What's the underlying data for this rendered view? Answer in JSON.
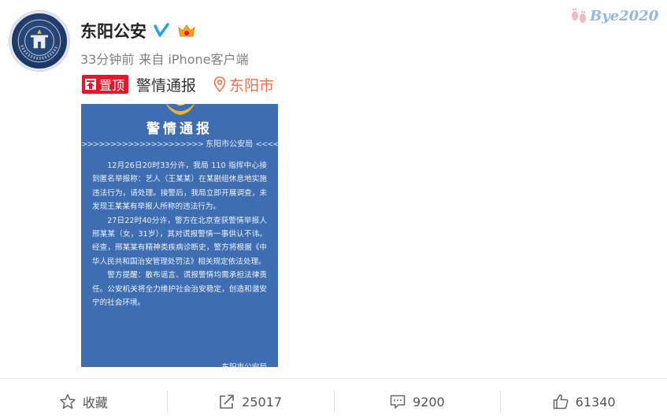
{
  "user": {
    "name": "东阳公安",
    "meta": {
      "time": "33分钟前",
      "source": "来自 iPhone客户端"
    }
  },
  "post": {
    "pin_label": "置顶",
    "text": "警情通报",
    "location": "东阳市"
  },
  "notice": {
    "title": "警情通报",
    "subtitle": "东阳市公安局",
    "arrows_left": ">>>>>>>>>>>>>>>>>>>>>",
    "arrows_right": "<<<<<<<<<<<<<<<<<<<<<",
    "paragraphs": [
      "12月26日20时33分许，我局 110 指挥中心接到匿名举报称：艺人（王某某）在某剧组休息地实施违法行为，请处理。接警后，我局立即开展调查，未发现王某某有举报人所称的违法行为。",
      "27日22时40分许，警方在北京查获警情举报人邢某某（女，31岁），其对谎报警情一事供认不讳。经查，邢某某有精神类疾病诊断史，警方将根据《中华人民共和国治安管理处罚法》相关规定依法处理。",
      "警方提醒：散布谣言、谎报警情均需承担法律责任。公安机关将全力维护社会治安稳定，创造和谐安宁的社会环境。"
    ],
    "sign": "东阳市公安局"
  },
  "actions": {
    "favorite": "收藏",
    "repost": "25017",
    "comment": "9200",
    "like": "61340"
  },
  "badge": {
    "text": "Bye2020"
  },
  "colors": {
    "pin": "#e6162d",
    "location": "#eb7350",
    "notice_bg": "#3e6db2",
    "verify": "#1da1f2"
  }
}
